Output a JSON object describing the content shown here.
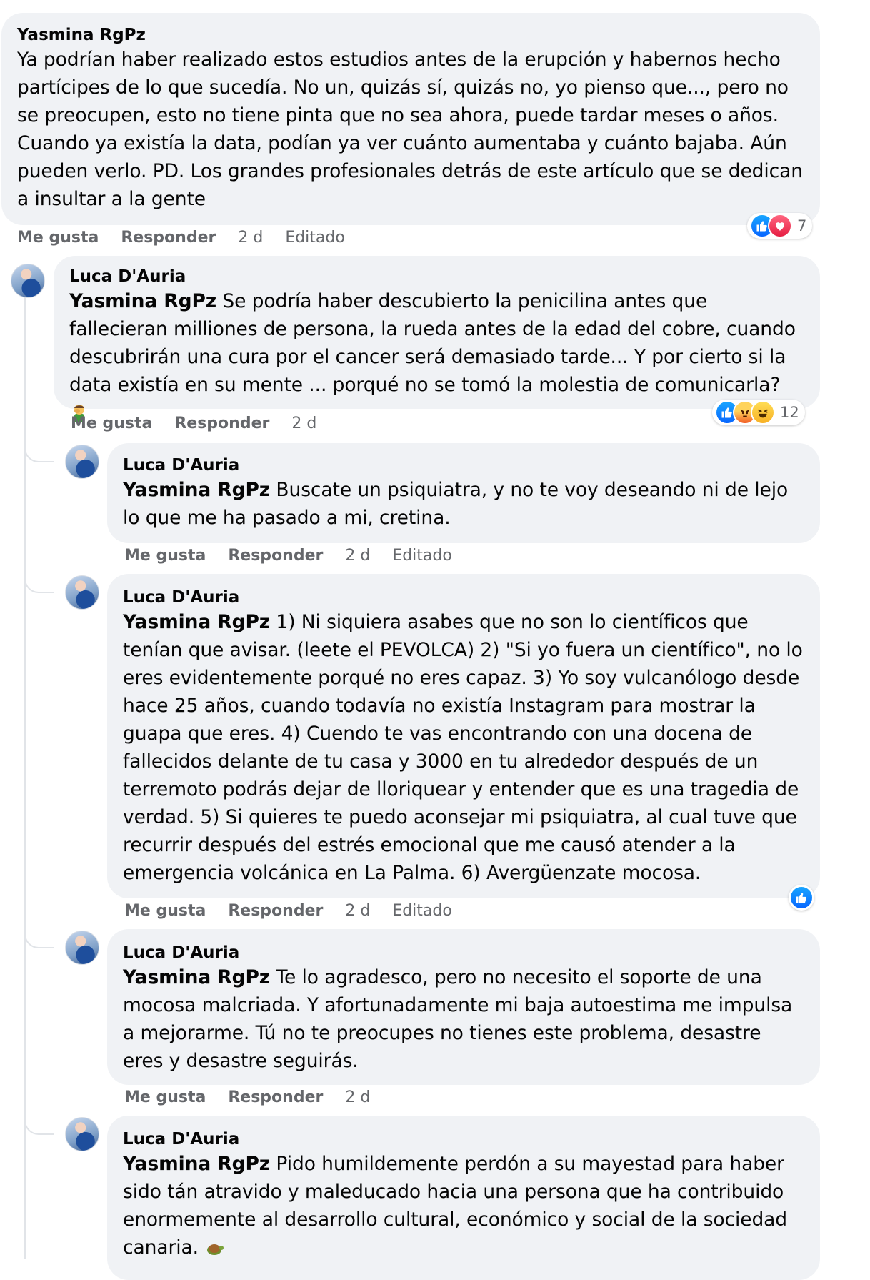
{
  "comments": [
    {
      "author": "Yasmina RgPz",
      "mention": "",
      "text": "Ya podrían haber realizado estos estudios antes de la erupción y habernos hecho partícipes de lo que sucedía. No un, quizás sí, quizás no, yo pienso que..., pero no se preocupen, esto no tiene pinta que no sea ahora, puede tardar meses o años. Cuando ya existía la data, podían ya ver cuánto aumentaba y cuánto bajaba. Aún pueden verlo. PD. Los grandes profesionales detrás de este artículo que se dedican a insultar a la gente",
      "like": "Me gusta",
      "reply": "Responder",
      "time": "2 d",
      "edited": "Editado",
      "reactions": {
        "types": [
          "like-icon",
          "love-icon"
        ],
        "count": "7"
      }
    },
    {
      "author": "Luca D'Auria",
      "mention": "Yasmina RgPz",
      "text": " Se podría haber descubierto la penicilina antes que fallecieran milliones de persona, la rueda antes de la edad del cobre, cuando descubrirán una cura por el cancer será demasiado tarde... Y por cierto si la data existía en su mente ... porqué no se tomó la molestia de comunicarla? ",
      "like": "Me gusta",
      "reply": "Responder",
      "time": "2 d",
      "reactions": {
        "types": [
          "like-icon",
          "angry-icon",
          "haha-icon"
        ],
        "count": "12"
      }
    },
    {
      "author": "Luca D'Auria",
      "mention": "Yasmina RgPz",
      "text": " Buscate un psiquiatra, y no te voy deseando ni de lejo lo que me ha pasado a mi, cretina.",
      "like": "Me gusta",
      "reply": "Responder",
      "time": "2 d",
      "edited": "Editado"
    },
    {
      "author": "Luca D'Auria",
      "mention": "Yasmina RgPz",
      "text": " 1) Ni siquiera asabes que no son lo científicos que tenían que avisar. (leete el PEVOLCA) 2) \"Si yo fuera un científico\", no lo eres evidentemente porqué no eres capaz. 3) Yo soy vulcanólogo desde hace 25 años, cuando todavía no existía Instagram para mostrar la guapa que eres. 4) Cuendo te vas encontrando con una docena de fallecidos delante de tu casa y 3000 en tu alrededor después de un terremoto podrás dejar de lloriquear y entender que es una tragedia de verdad. 5) Si quieres te puedo aconsejar mi psiquiatra, al cual tuve que recurrir después del estrés emocional que me causó atender a la emergencia volcánica en La Palma. 6) Avergüenzate mocosa.",
      "like": "Me gusta",
      "reply": "Responder",
      "time": "2 d",
      "edited": "Editado",
      "reactions": {
        "types": [
          "like-icon"
        ]
      }
    },
    {
      "author": "Luca D'Auria",
      "mention": "Yasmina RgPz",
      "text": " Te lo agradesco, pero no necesito el soporte de una mocosa malcriada. Y afortunadamente mi baja autoestima me impulsa a mejorarme. Tú no te preocupes no tienes este problema, desastre eres y desastre seguirás.",
      "like": "Me gusta",
      "reply": "Responder",
      "time": "2 d"
    },
    {
      "author": "Luca D'Auria",
      "mention": "Yasmina RgPz",
      "text": " Pido humildemente perdón a su mayestad para haber sido tán atravido y maleducado hacia una persona que ha contribuido enormemente al desarrollo cultural, económico y social de la sociedad canaria. "
    }
  ],
  "emojis": {
    "c1_inline": "man-facepalming-emoji",
    "c5_inline": "turtle-emoji"
  }
}
